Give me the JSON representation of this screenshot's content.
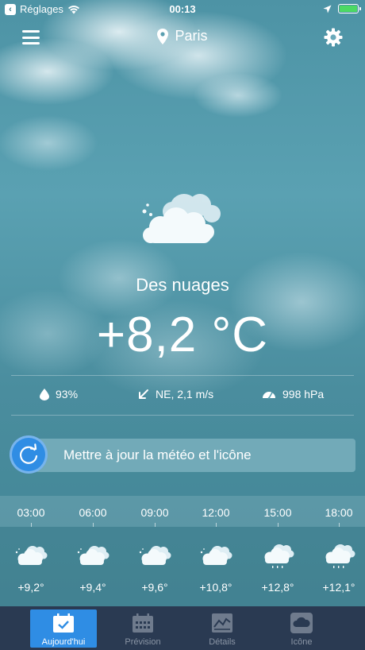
{
  "status_bar": {
    "back_app": "Réglages",
    "time": "00:13"
  },
  "header": {
    "city": "Paris",
    "menu_icon": "hamburger-menu-icon",
    "location_icon": "map-pin-icon",
    "settings_icon": "gear-icon"
  },
  "current": {
    "icon": "cloudy-icon",
    "condition": "Des nuages",
    "temperature": "+8,2 °C",
    "humidity": "93%",
    "wind": "NE, 2,1 m/s",
    "pressure": "998 hPa"
  },
  "update": {
    "label": "Mettre à jour la météo et l'icône"
  },
  "hourly": [
    {
      "time": "03:00",
      "temp": "+9,2°",
      "icon": "cloudy-icon"
    },
    {
      "time": "06:00",
      "temp": "+9,4°",
      "icon": "cloudy-icon"
    },
    {
      "time": "09:00",
      "temp": "+9,6°",
      "icon": "cloudy-icon"
    },
    {
      "time": "12:00",
      "temp": "+10,8°",
      "icon": "cloudy-icon"
    },
    {
      "time": "15:00",
      "temp": "+12,8°",
      "icon": "light-rain-icon"
    },
    {
      "time": "18:00",
      "temp": "+12,1°",
      "icon": "light-rain-icon"
    }
  ],
  "tabs": [
    {
      "label": "Aujourd'hui",
      "icon": "calendar-check-icon",
      "active": true
    },
    {
      "label": "Prévision",
      "icon": "calendar-grid-icon",
      "active": false
    },
    {
      "label": "Détails",
      "icon": "chart-icon",
      "active": false
    },
    {
      "label": "Icône",
      "icon": "cloud-app-icon",
      "active": false
    }
  ],
  "colors": {
    "accent": "#2f8de4",
    "tabbar": "#2a3a52",
    "battery": "#4cd964"
  }
}
